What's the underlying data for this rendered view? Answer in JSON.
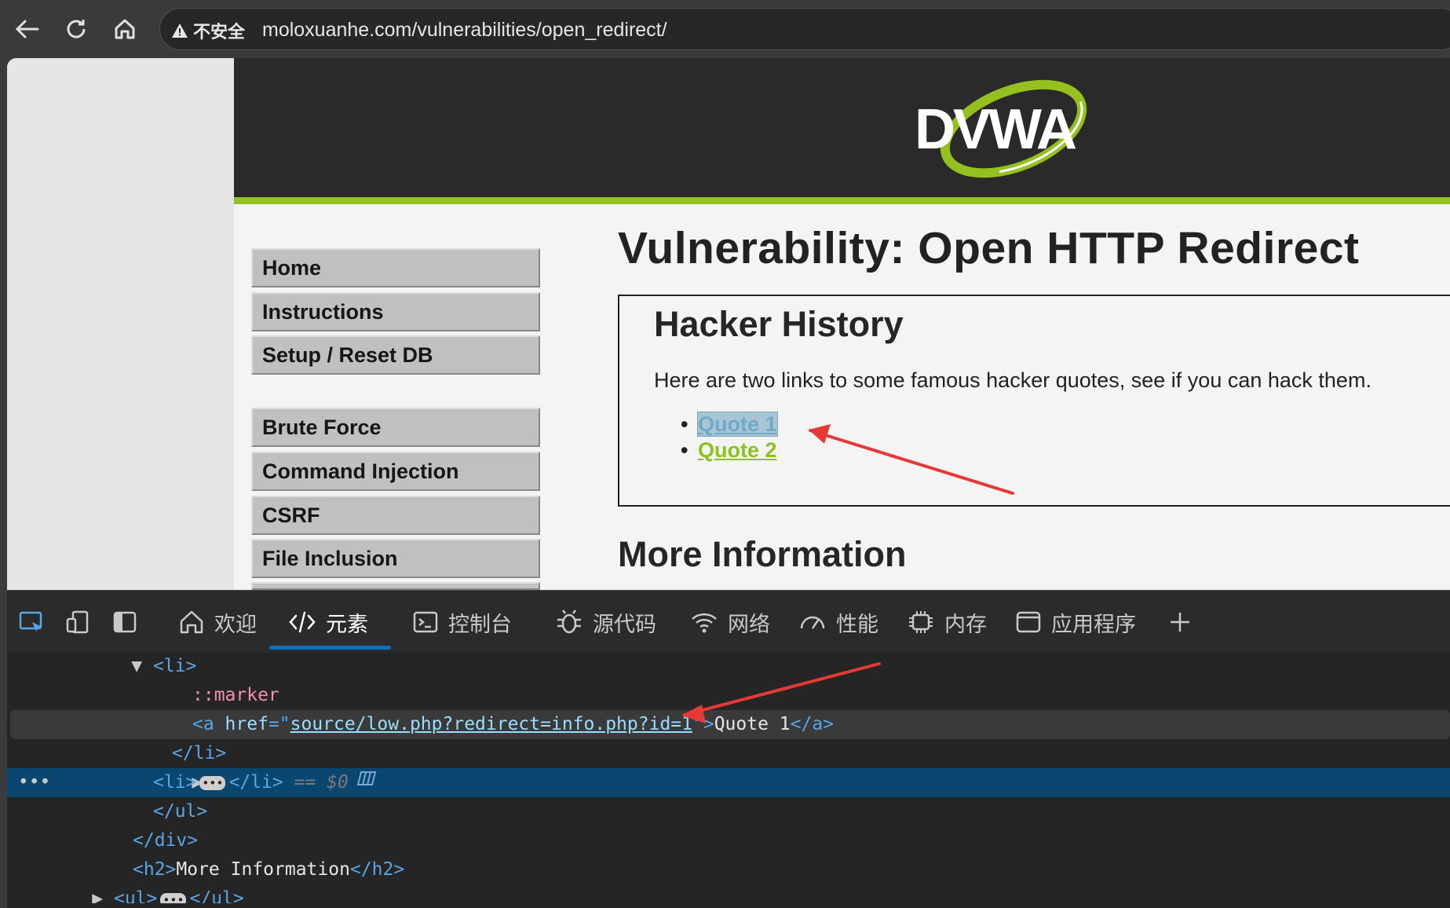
{
  "browser": {
    "security_label": "不安全",
    "url": "moloxuanhe.com/vulnerabilities/open_redirect/"
  },
  "page": {
    "logo_text": "DVWA",
    "menu": [
      "Home",
      "Instructions",
      "Setup / Reset DB",
      "Brute Force",
      "Command Injection",
      "CSRF",
      "File Inclusion"
    ],
    "title": "Vulnerability: Open HTTP Redirect",
    "box_heading": "Hacker History",
    "box_text": "Here are two links to some famous hacker quotes, see if you can hack them.",
    "links": [
      "Quote 1",
      "Quote 2"
    ],
    "more_info": "More Information"
  },
  "devtools": {
    "tabs": [
      "欢迎",
      "元素",
      "控制台",
      "源代码",
      "网络",
      "性能",
      "内存",
      "应用程序"
    ],
    "lines": {
      "l1": "<li>",
      "l2": "::marker",
      "l3_href": "source/low.php?redirect=info.php?id=1",
      "l3_text": "Quote 1",
      "l4": "</li>",
      "l5_dollar": "$0",
      "l6": "</ul>",
      "l7": "</div>",
      "l8_text": "More Information"
    }
  },
  "colors": {
    "accent_green": "#94c11f",
    "devtools_select": "#094771",
    "arrow_red": "#e53935"
  }
}
